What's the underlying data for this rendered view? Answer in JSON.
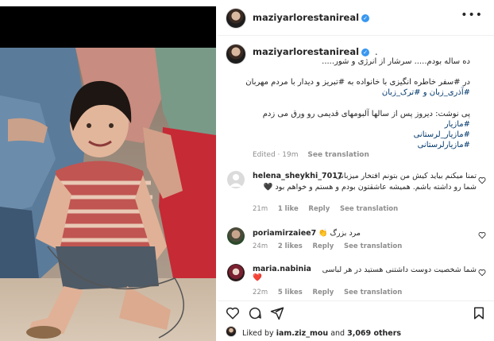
{
  "post": {
    "username": "maziyarlorestanireal",
    "verified_mark": "✓",
    "more_icon": "•••"
  },
  "caption": {
    "username": "maziyarlorestanireal",
    "dot": ".",
    "line1": "ده ساله بودم..... سرشار از انرژی و شور.....",
    "line2": "در #سفر خاطره انگیزی با خانواده به #تبریز و دیدار با مردم مهربان",
    "line3": "#آذری_زبان و #ترک_زبان",
    "line4": "پی نوشت: دیروز پس از سالها آلبومهای قدیمی رو ورق می زدم",
    "line5": "#مازیار",
    "line6": "#مازیار_لرستانی",
    "line7": "#مازیارلرستانی",
    "edited": "Edited · 19m",
    "see_translation": "See translation"
  },
  "comments": [
    {
      "username": "helena_sheykhi_7017",
      "text1": "تمنا میکنم بیاید کیش من بتونم افتخار میزبانی",
      "text2": "شما رو داشته باشم. همیشه عاشقتون بودم و هستم و خواهم بود 🖤",
      "time": "21m",
      "likes": "1 like",
      "reply": "Reply",
      "see_translation": "See translation"
    },
    {
      "username": "poriamirzaiee7",
      "text1": "مرد بزرگ 👏",
      "time": "24m",
      "likes": "2 likes",
      "reply": "Reply",
      "see_translation": "See translation"
    },
    {
      "username": "maria.nabinia",
      "text1": "شما شخصیت دوست داشتنی هستید در هر لباسی",
      "text2": "❤️",
      "time": "22m",
      "likes": "5 likes",
      "reply": "Reply",
      "see_translation": "See translation"
    }
  ],
  "likes_line": {
    "prefix": "Liked by",
    "user": "iam.ziz_mou",
    "and": "and",
    "others": "3,069 others"
  },
  "colors": {
    "link": "#00376b",
    "muted": "#8e8e8e",
    "verified": "#3897f0",
    "heart_red": "#ed4956"
  },
  "icons": [
    "heart-icon",
    "comment-icon",
    "share-icon",
    "bookmark-icon",
    "more-icon",
    "verified-icon"
  ]
}
